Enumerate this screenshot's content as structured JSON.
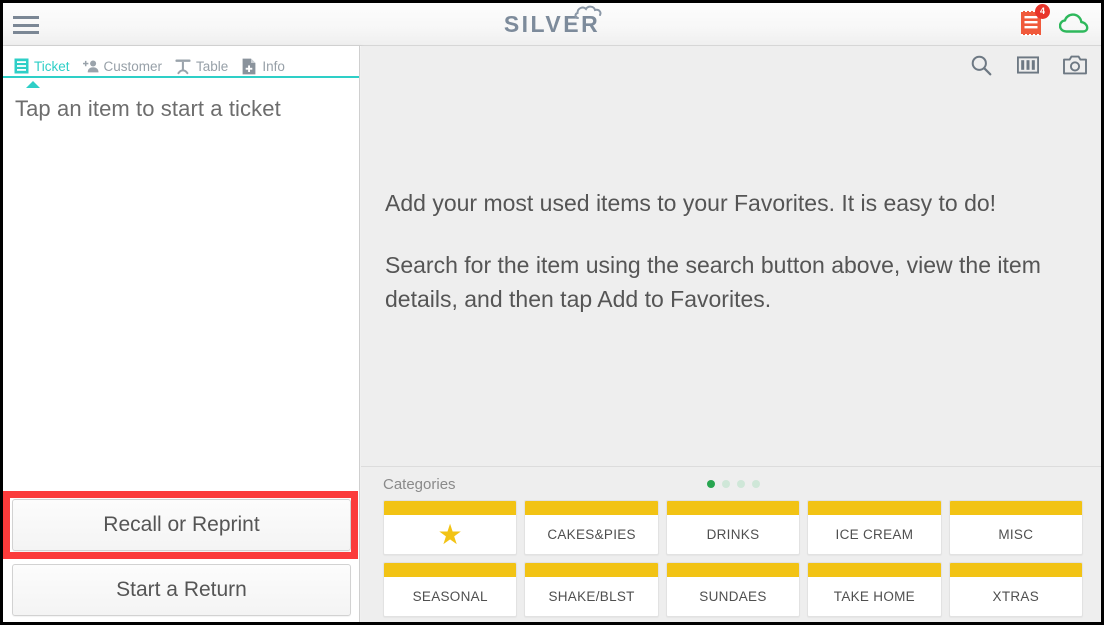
{
  "header": {
    "menu_icon": "hamburger-menu-icon",
    "logo_text": "SILVER",
    "logo_cloud_icon": "cloud-icon",
    "receipt_icon": "receipt-icon",
    "receipt_badge_count": "4",
    "cloud_sync_icon": "cloud-icon",
    "colors": {
      "receipt": "#f05a3c",
      "badge": "#e8342a",
      "cloud": "#2eb85c",
      "logo": "#7d8b9b"
    }
  },
  "left_panel": {
    "tabs": [
      {
        "label": "Ticket",
        "icon": "ticket-icon",
        "active": true
      },
      {
        "label": "Customer",
        "icon": "add-person-icon",
        "active": false
      },
      {
        "label": "Table",
        "icon": "table-icon",
        "active": false
      },
      {
        "label": "Info",
        "icon": "add-document-icon",
        "active": false
      }
    ],
    "hint_text": "Tap an item to start a ticket",
    "buttons": [
      {
        "label": "Recall or Reprint",
        "highlighted": true
      },
      {
        "label": "Start a Return",
        "highlighted": false
      }
    ],
    "accent_color": "#2ecfc7",
    "highlight_color": "#fb3b3b"
  },
  "main": {
    "toolbar": [
      {
        "icon": "search-icon"
      },
      {
        "icon": "columns-layout-icon"
      },
      {
        "icon": "camera-icon"
      }
    ],
    "paragraphs": [
      "Add your most used items to your Favorites. It is easy to do!",
      "Search for the item using the search button above, view the item details, and then tap Add to Favorites."
    ],
    "categories": {
      "title": "Categories",
      "page_dots": {
        "total": 4,
        "active_index": 0
      },
      "accent_color": "#f2c314",
      "tiles": [
        {
          "label": "",
          "icon": "star-icon"
        },
        {
          "label": "CAKES&PIES",
          "icon": ""
        },
        {
          "label": "DRINKS",
          "icon": ""
        },
        {
          "label": "ICE CREAM",
          "icon": ""
        },
        {
          "label": "MISC",
          "icon": ""
        },
        {
          "label": "SEASONAL",
          "icon": ""
        },
        {
          "label": "SHAKE/BLST",
          "icon": ""
        },
        {
          "label": "SUNDAES",
          "icon": ""
        },
        {
          "label": "TAKE HOME",
          "icon": ""
        },
        {
          "label": "XTRAS",
          "icon": ""
        }
      ]
    }
  }
}
